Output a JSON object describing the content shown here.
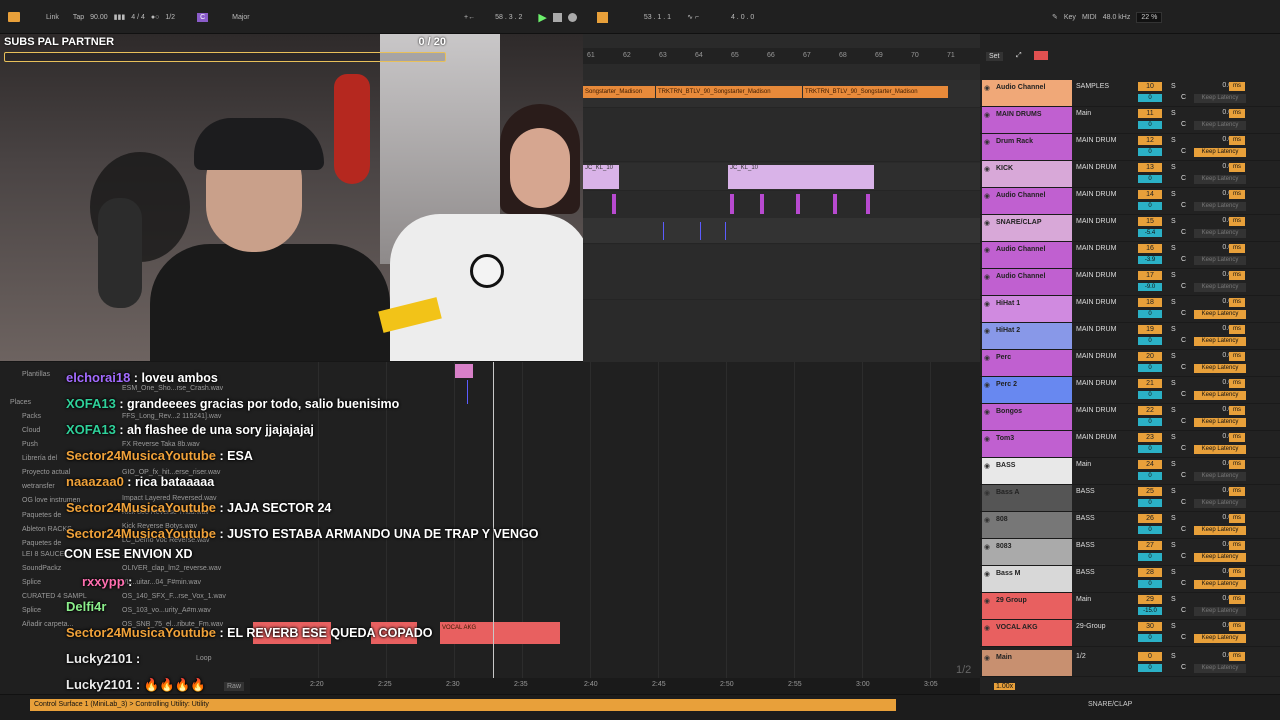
{
  "topbar": {
    "link": "Link",
    "tap": "Tap",
    "tempo": "90.00",
    "signature": "4 / 4",
    "quantize": "1/2",
    "key_root": "C",
    "scale": "Major",
    "position": "58 . 3 . 2",
    "loop_start": "53 . 1 . 1",
    "loop_length": "4 . 0 . 0",
    "key_label": "Key",
    "midi_label": "MIDI",
    "sample_rate": "48.0 kHz",
    "cpu": "22 %"
  },
  "overlay": {
    "subs_label": "SUBS PAL PARTNER",
    "subs_count": "0 / 20",
    "subs_progress": 0
  },
  "ruler": [
    "61",
    "62",
    "63",
    "64",
    "65",
    "66",
    "67",
    "68",
    "69",
    "70",
    "71"
  ],
  "mixer_header": {
    "set": "Set"
  },
  "arrangement": {
    "audio_clip_name": "Songstarter_Madison",
    "audio_clip_name2": "TRKTRN_BTLV_90_Songstarter_Madison",
    "midi_clip_name": "JC_KL_10",
    "vocal_clip": "VOCAL AKG"
  },
  "browser": {
    "sidebar": [
      "Plantillas",
      "Places",
      "Packs",
      "Cloud",
      "Push",
      "Librería del",
      "Proyecto actual",
      "wetransfer",
      "OG love instrumen",
      "Paquetes de",
      "Ableton RACKS",
      "Paquetes de",
      "LEI 8 SAUCE",
      "SoundPackz",
      "Splice",
      "CURATED 4 SAMPL",
      "Splice",
      "Añadir carpeta..."
    ],
    "files": [
      "ESM_One_Sho...rse_Crash.wav",
      "FFS_Long_Rev...2 115241].wav",
      "FX Reverse Taka 8b.wav",
      "GIO_OP_fx_hit...erse_riser.wav",
      "Impact Layered Reversed.wav",
      "Kick 808 Reverse Thud.wav",
      "Kick Reverse Botys.wav",
      "LC_Demo Voc Reverse.wav",
      "..._FX_04.wav",
      "OLIVER_clap_lm2_reverse.wav",
      "VL...uitar...04_F#min.wav",
      "OS_140_SFX_F...rse_Vox_1.wav",
      "OS_103_vo...urity_A#m.wav",
      "OS_SNB_75_el...ribute_Fm.wav",
      "Loop",
      "Raw"
    ]
  },
  "chat": [
    {
      "user": "elchorai18",
      "text": "loveu ambos",
      "color": "purple"
    },
    {
      "user": "XOFA13",
      "text": "grandeeees gracias por todo, salio buenisimo",
      "color": "green"
    },
    {
      "user": "XOFA13",
      "text": "ah flashee de una sory jjajajajaj",
      "color": "green"
    },
    {
      "user": "Sector24MusicaYoutube",
      "text": "ESA",
      "color": "orange"
    },
    {
      "user": "naaazaa0",
      "text": "rica bataaaaa",
      "color": "orange"
    },
    {
      "user": "Sector24MusicaYoutube",
      "text": "JAJA SECTOR 24",
      "color": "orange"
    },
    {
      "user": "Sector24MusicaYoutube",
      "text": "JUSTO ESTABA ARMANDO UNA DE TRAP Y VENGO",
      "color": "orange"
    },
    {
      "user": "",
      "text": "CON ESE ENVION XD",
      "color": "white"
    },
    {
      "user": "rxxypp",
      "text": "",
      "color": "pink"
    },
    {
      "user": "Delfi4r",
      "text": "",
      "color": "lgreen"
    },
    {
      "user": "Sector24MusicaYoutube",
      "text": "EL REVERB ESE QUEDA COPADO",
      "color": "orange"
    },
    {
      "user": "Lucky2101",
      "text": "",
      "color": "white"
    },
    {
      "user": "Lucky2101",
      "text": "🔥🔥🔥🔥",
      "color": "white"
    }
  ],
  "timeline": [
    "2:20",
    "2:25",
    "2:30",
    "2:35",
    "2:40",
    "2:45",
    "2:50",
    "2:55",
    "3:00",
    "3:05"
  ],
  "zoom_fraction": "1/2",
  "tracks": [
    {
      "name": "Audio Channel",
      "io": "SAMPLES",
      "num": "10",
      "vol": "0",
      "lat": "0.00",
      "color": "#f0a878",
      "keep": "Keep Latency",
      "keep_active": false
    },
    {
      "name": "MAIN DRUMS",
      "io": "Main",
      "num": "11",
      "vol": "0",
      "lat": "0.00",
      "color": "#c060d0",
      "keep": "Keep Latency",
      "keep_active": false
    },
    {
      "name": "Drum Rack",
      "io": "MAIN DRUM",
      "num": "12",
      "vol": "0",
      "lat": "0.00",
      "color": "#c060d0",
      "keep": "Keep Latency",
      "keep_active": true
    },
    {
      "name": "KICK",
      "io": "MAIN DRUM",
      "num": "13",
      "vol": "0",
      "lat": "0.00",
      "color": "#d8a8d8",
      "keep": "Keep Latency",
      "keep_active": false
    },
    {
      "name": "Audio Channel",
      "io": "MAIN DRUM",
      "num": "14",
      "vol": "0",
      "lat": "0.00",
      "color": "#c060d0",
      "keep": "Keep Latency",
      "keep_active": false
    },
    {
      "name": "SNARE/CLAP",
      "io": "MAIN DRUM",
      "num": "15",
      "vol": "-5.4",
      "lat": "0.00",
      "color": "#d8a8d8",
      "keep": "Keep Latency",
      "keep_active": false
    },
    {
      "name": "Audio Channel",
      "io": "MAIN DRUM",
      "num": "16",
      "vol": "-3.9",
      "lat": "0.00",
      "color": "#c060d0",
      "keep": "Keep Latency",
      "keep_active": false
    },
    {
      "name": "Audio Channel",
      "io": "MAIN DRUM",
      "num": "17",
      "vol": "-9.0",
      "lat": "0.00",
      "color": "#c060d0",
      "keep": "Keep Latency",
      "keep_active": false
    },
    {
      "name": "HiHat 1",
      "io": "MAIN DRUM",
      "num": "18",
      "vol": "0",
      "lat": "0.00",
      "color": "#d08ae0",
      "keep": "Keep Latency",
      "keep_active": true
    },
    {
      "name": "HiHat 2",
      "io": "MAIN DRUM",
      "num": "19",
      "vol": "0",
      "lat": "0.00",
      "color": "#8898e8",
      "keep": "Keep Latency",
      "keep_active": true
    },
    {
      "name": "Perc",
      "io": "MAIN DRUM",
      "num": "20",
      "vol": "0",
      "lat": "0.00",
      "color": "#c060d0",
      "keep": "Keep Latency",
      "keep_active": true
    },
    {
      "name": "Perc 2",
      "io": "MAIN DRUM",
      "num": "21",
      "vol": "0",
      "lat": "0.00",
      "color": "#6888f0",
      "keep": "Keep Latency",
      "keep_active": true
    },
    {
      "name": "Bongos",
      "io": "MAIN DRUM",
      "num": "22",
      "vol": "0",
      "lat": "0.00",
      "color": "#c060d0",
      "keep": "Keep Latency",
      "keep_active": true
    },
    {
      "name": "Tom3",
      "io": "MAIN DRUM",
      "num": "23",
      "vol": "0",
      "lat": "0.00",
      "color": "#c060d0",
      "keep": "Keep Latency",
      "keep_active": true
    },
    {
      "name": "BASS",
      "io": "Main",
      "num": "24",
      "vol": "0",
      "lat": "0.00",
      "color": "#e8e8e8",
      "keep": "Keep Latency",
      "keep_active": false
    },
    {
      "name": "Bass A",
      "io": "BASS",
      "num": "25",
      "vol": "0",
      "lat": "0.00",
      "color": "#555555",
      "keep": "Keep Latency",
      "keep_active": false
    },
    {
      "name": "808",
      "io": "BASS",
      "num": "26",
      "vol": "0",
      "lat": "0.00",
      "color": "#777777",
      "keep": "Keep Latency",
      "keep_active": true
    },
    {
      "name": "8083",
      "io": "BASS",
      "num": "27",
      "vol": "0",
      "lat": "0.00",
      "color": "#aaaaaa",
      "keep": "Keep Latency",
      "keep_active": true
    },
    {
      "name": "Bass M",
      "io": "BASS",
      "num": "28",
      "vol": "0",
      "lat": "0.00",
      "color": "#d8d8d8",
      "keep": "Keep Latency",
      "keep_active": true
    },
    {
      "name": "29 Group",
      "io": "Main",
      "num": "29",
      "vol": "-15.0",
      "lat": "0.00",
      "color": "#e86060",
      "keep": "Keep Latency",
      "keep_active": false
    },
    {
      "name": "VOCAL AKG",
      "io": "29-Group",
      "num": "30",
      "vol": "0",
      "lat": "0.00",
      "color": "#e86060",
      "keep": "Keep Latency",
      "keep_active": true
    },
    {
      "name": "Main",
      "io": "1/2",
      "num": "0",
      "vol": "0",
      "lat": "0.00",
      "color": "#c89070",
      "keep": "Keep Latency",
      "keep_active": false
    }
  ],
  "status": {
    "message": "Control Surface 1 (MiniLab_3) > Controlling Utility: Utility",
    "right": "SNARE/CLAP",
    "zoom": "1.00x"
  }
}
